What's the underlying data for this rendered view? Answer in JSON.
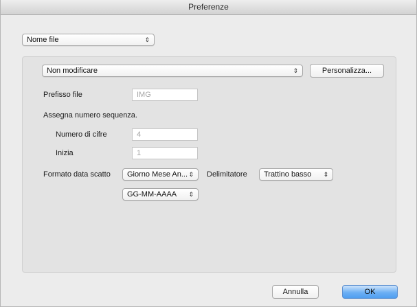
{
  "window": {
    "title": "Preferenze"
  },
  "category_popup": {
    "value": "Nome file"
  },
  "file_name": {
    "mode_popup": {
      "value": "Non modificare"
    },
    "customize_button": "Personalizza...",
    "prefix": {
      "label": "Prefisso file",
      "value": "IMG"
    },
    "sequence_heading": "Assegna numero sequenza.",
    "digits": {
      "label": "Numero di cifre",
      "value": "4"
    },
    "start": {
      "label": "Inizia",
      "value": "1"
    },
    "date_format": {
      "label": "Formato data scatto",
      "order_value": "Giorno Mese An...",
      "pattern_value": "GG-MM-AAAA"
    },
    "delimiter": {
      "label": "Delimitatore",
      "value": "Trattino basso"
    }
  },
  "footer": {
    "cancel_label": "Annulla",
    "ok_label": "OK"
  },
  "icons": {
    "popup_arrows": "⇕"
  }
}
